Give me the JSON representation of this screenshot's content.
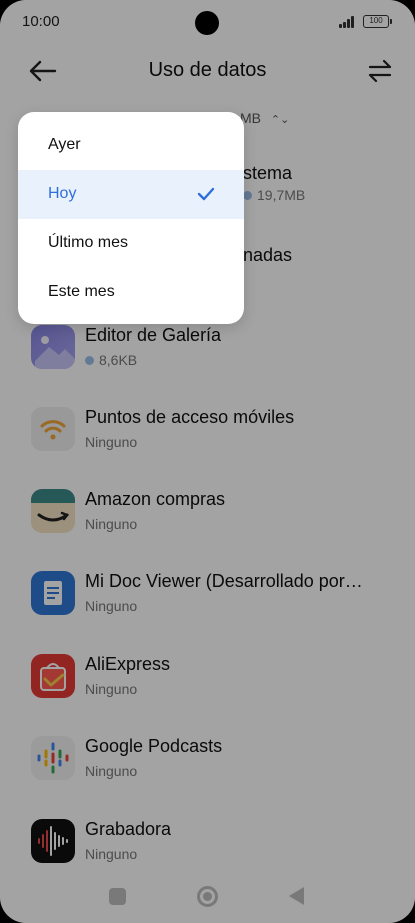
{
  "status_bar": {
    "time": "10:00",
    "battery": "100"
  },
  "header": {
    "title": "Uso de datos"
  },
  "period_row": {
    "visible_fragment": "MB"
  },
  "apps": [
    {
      "name": "stema",
      "usage": "19,7MB",
      "has_dot": true
    },
    {
      "name": "nadas",
      "usage": "",
      "has_dot": false
    },
    {
      "name": "Editor de Galería",
      "usage": "8,6KB",
      "has_dot": true
    },
    {
      "name": "Puntos de acceso móviles",
      "usage": "Ninguno",
      "has_dot": false
    },
    {
      "name": "Amazon compras",
      "usage": "Ninguno",
      "has_dot": false
    },
    {
      "name": "Mi Doc Viewer (Desarrollado por…",
      "usage": "Ninguno",
      "has_dot": false
    },
    {
      "name": "AliExpress",
      "usage": "Ninguno",
      "has_dot": false
    },
    {
      "name": "Google Podcasts",
      "usage": "Ninguno",
      "has_dot": false
    },
    {
      "name": "Grabadora",
      "usage": "Ninguno",
      "has_dot": false
    }
  ],
  "dropdown": {
    "options": [
      "Ayer",
      "Hoy",
      "Último mes",
      "Este mes"
    ],
    "selected": "Hoy"
  },
  "colors": {
    "accent": "#2f6fdb",
    "selected_bg": "#e9f1fc",
    "usage_dot": "#9bbfe8"
  }
}
